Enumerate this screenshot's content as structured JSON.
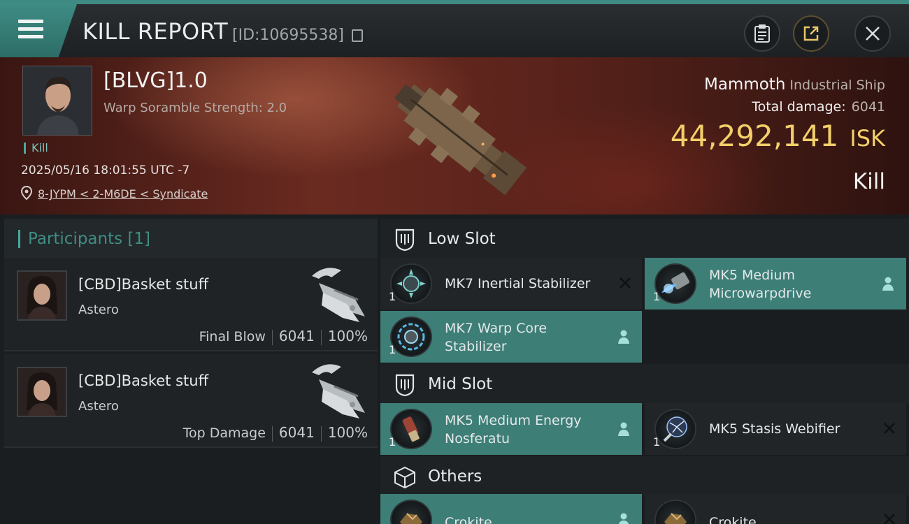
{
  "header": {
    "title": "KILL REPORT",
    "report_id": "[ID:10695538]"
  },
  "victim": {
    "name": "[BLVG]1.0",
    "scramble": "Warp Soramble Strength: 2.0",
    "tag": "Kill",
    "datetime": "2025/05/16 18:01:55 UTC -7",
    "location": "8-JYPM < 2-M6DE < Syndicate"
  },
  "ship": {
    "name": "Mammoth",
    "class": "Industrial Ship",
    "total_damage_label": "Total damage:",
    "total_damage_value": "6041",
    "isk_value": "44,292,141",
    "isk_unit": "ISK",
    "result": "Kill"
  },
  "participants": {
    "title": "Participants [1]",
    "items": [
      {
        "name": "[CBD]Basket stuff",
        "ship": "Astero",
        "role": "Final Blow",
        "damage": "6041",
        "percent": "100%"
      },
      {
        "name": "[CBD]Basket stuff",
        "ship": "Astero",
        "role": "Top Damage",
        "damage": "6041",
        "percent": "100%"
      }
    ]
  },
  "slots": {
    "low": {
      "title": "Low Slot",
      "items": [
        {
          "qty": "1",
          "name": "MK7 Inertial Stabilizer",
          "state": "destroyed"
        },
        {
          "qty": "1",
          "name": "MK5 Medium Microwarpdrive",
          "state": "dropped"
        },
        {
          "qty": "1",
          "name": "MK7 Warp Core Stabilizer",
          "state": "dropped"
        }
      ]
    },
    "mid": {
      "title": "Mid Slot",
      "items": [
        {
          "qty": "1",
          "name": "MK5 Medium Energy Nosferatu",
          "state": "dropped"
        },
        {
          "qty": "1",
          "name": "MK5 Stasis Webifier",
          "state": "destroyed"
        }
      ]
    },
    "others": {
      "title": "Others",
      "items": [
        {
          "name": "Crokite",
          "state": "dropped"
        },
        {
          "name": "Crokite",
          "state": "destroyed"
        }
      ]
    }
  },
  "colors": {
    "accent": "#3f8a83",
    "isk": "#f2cf6a",
    "active_module": "#3d7e77"
  }
}
